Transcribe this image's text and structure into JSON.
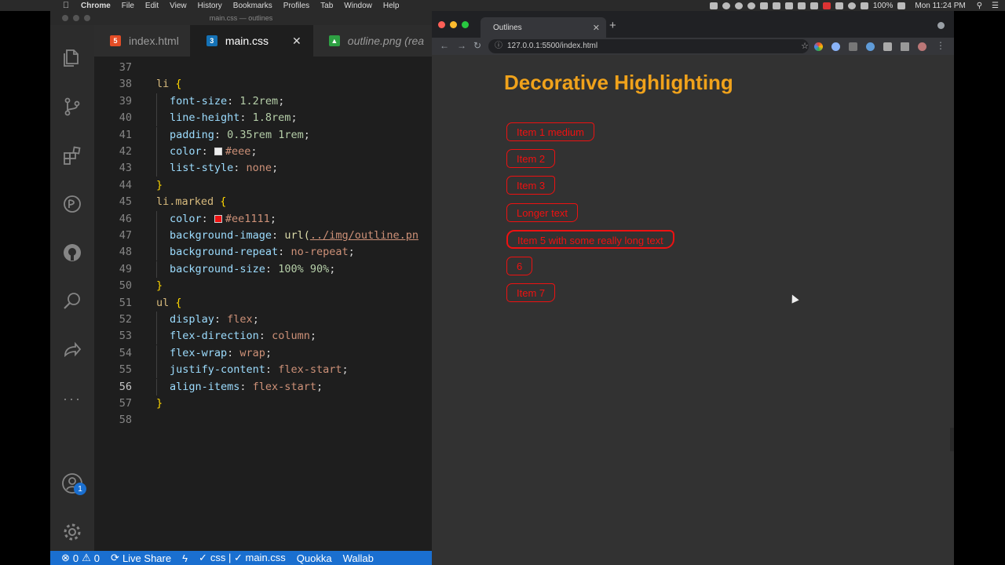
{
  "menubar": {
    "app": "Chrome",
    "items": [
      "File",
      "Edit",
      "View",
      "History",
      "Bookmarks",
      "Profiles",
      "Tab",
      "Window",
      "Help"
    ],
    "battery": "100%",
    "clock": "Mon 11:24 PM"
  },
  "vscode": {
    "title": "main.css — outlines",
    "tabs": [
      {
        "label": "index.html",
        "icon": "html5-icon",
        "color": "#e44d26"
      },
      {
        "label": "main.css",
        "icon": "css3-icon",
        "color": "#1572b6",
        "active": true
      },
      {
        "label": "outline.png (rea",
        "icon": "image-icon",
        "color": "#2ea043"
      }
    ],
    "notification_count": "1",
    "lines": [
      {
        "n": "37",
        "tokens": []
      },
      {
        "n": "38",
        "tokens": [
          [
            "sel",
            "li "
          ],
          [
            "brace",
            "{"
          ]
        ]
      },
      {
        "n": "39",
        "indent": true,
        "tokens": [
          [
            "prop",
            "font-size"
          ],
          [
            "punc",
            ": "
          ],
          [
            "num",
            "1.2rem"
          ],
          [
            "punc",
            ";"
          ]
        ]
      },
      {
        "n": "40",
        "indent": true,
        "tokens": [
          [
            "prop",
            "line-height"
          ],
          [
            "punc",
            ": "
          ],
          [
            "num",
            "1.8rem"
          ],
          [
            "punc",
            ";"
          ]
        ]
      },
      {
        "n": "41",
        "indent": true,
        "tokens": [
          [
            "prop",
            "padding"
          ],
          [
            "punc",
            ": "
          ],
          [
            "num",
            "0.35rem 1rem"
          ],
          [
            "punc",
            ";"
          ]
        ]
      },
      {
        "n": "42",
        "indent": true,
        "tokens": [
          [
            "prop",
            "color"
          ],
          [
            "punc",
            ": "
          ],
          [
            "swatch:#eeeeee",
            ""
          ],
          [
            "val",
            "#eee"
          ],
          [
            "punc",
            ";"
          ]
        ]
      },
      {
        "n": "43",
        "indent": true,
        "tokens": [
          [
            "prop",
            "list-style"
          ],
          [
            "punc",
            ": "
          ],
          [
            "val",
            "none"
          ],
          [
            "punc",
            ";"
          ]
        ]
      },
      {
        "n": "44",
        "tokens": [
          [
            "brace",
            "}"
          ]
        ]
      },
      {
        "n": "45",
        "tokens": [
          [
            "sel",
            "li.marked "
          ],
          [
            "brace",
            "{"
          ]
        ]
      },
      {
        "n": "46",
        "indent": true,
        "tokens": [
          [
            "prop",
            "color"
          ],
          [
            "punc",
            ": "
          ],
          [
            "swatch:#ee1111",
            ""
          ],
          [
            "val",
            "#ee1111"
          ],
          [
            "punc",
            ";"
          ]
        ]
      },
      {
        "n": "47",
        "indent": true,
        "tokens": [
          [
            "prop",
            "background-image"
          ],
          [
            "punc",
            ": "
          ],
          [
            "fn",
            "url("
          ],
          [
            "link",
            "../img/outline.pn"
          ]
        ]
      },
      {
        "n": "48",
        "indent": true,
        "tokens": [
          [
            "prop",
            "background-repeat"
          ],
          [
            "punc",
            ": "
          ],
          [
            "val",
            "no-repeat"
          ],
          [
            "punc",
            ";"
          ]
        ]
      },
      {
        "n": "49",
        "indent": true,
        "tokens": [
          [
            "prop",
            "background-size"
          ],
          [
            "punc",
            ": "
          ],
          [
            "num",
            "100% 90%"
          ],
          [
            "punc",
            ";"
          ]
        ]
      },
      {
        "n": "50",
        "tokens": [
          [
            "brace",
            "}"
          ]
        ]
      },
      {
        "n": "51",
        "tokens": [
          [
            "sel",
            "ul "
          ],
          [
            "brace",
            "{"
          ]
        ]
      },
      {
        "n": "52",
        "indent": true,
        "tokens": [
          [
            "prop",
            "display"
          ],
          [
            "punc",
            ": "
          ],
          [
            "val",
            "flex"
          ],
          [
            "punc",
            ";"
          ]
        ]
      },
      {
        "n": "53",
        "indent": true,
        "tokens": [
          [
            "prop",
            "flex-direction"
          ],
          [
            "punc",
            ": "
          ],
          [
            "val",
            "column"
          ],
          [
            "punc",
            ";"
          ]
        ]
      },
      {
        "n": "54",
        "indent": true,
        "tokens": [
          [
            "prop",
            "flex-wrap"
          ],
          [
            "punc",
            ": "
          ],
          [
            "val",
            "wrap"
          ],
          [
            "punc",
            ";"
          ]
        ]
      },
      {
        "n": "55",
        "indent": true,
        "tokens": [
          [
            "prop",
            "justify-content"
          ],
          [
            "punc",
            ": "
          ],
          [
            "val",
            "flex-start"
          ],
          [
            "punc",
            ";"
          ]
        ]
      },
      {
        "n": "56",
        "indent": true,
        "current": true,
        "tokens": [
          [
            "prop",
            "align-items"
          ],
          [
            "punc",
            ": "
          ],
          [
            "val",
            "flex-start"
          ],
          [
            "punc",
            ";"
          ]
        ]
      },
      {
        "n": "57",
        "tokens": [
          [
            "brace",
            "}"
          ]
        ]
      },
      {
        "n": "58",
        "tokens": []
      }
    ],
    "status": {
      "errors": "0",
      "warnings": "0",
      "live_share": "Live Share",
      "language": "css | ✓ main.css",
      "quokka": "Quokka",
      "wallaby": "Wallab"
    }
  },
  "chrome": {
    "tab_title": "Outlines",
    "url": "127.0.0.1:5500/index.html",
    "page": {
      "heading": "Decorative Highlighting",
      "items": [
        "Item 1 medium",
        "Item 2",
        "Item 3",
        "Longer text",
        "Item 5 with some really long text",
        "6",
        "Item 7"
      ]
    }
  },
  "colors": {
    "heading": "#f0a21b",
    "marked": "#ee1111",
    "statusbar": "#1a6fd0"
  }
}
